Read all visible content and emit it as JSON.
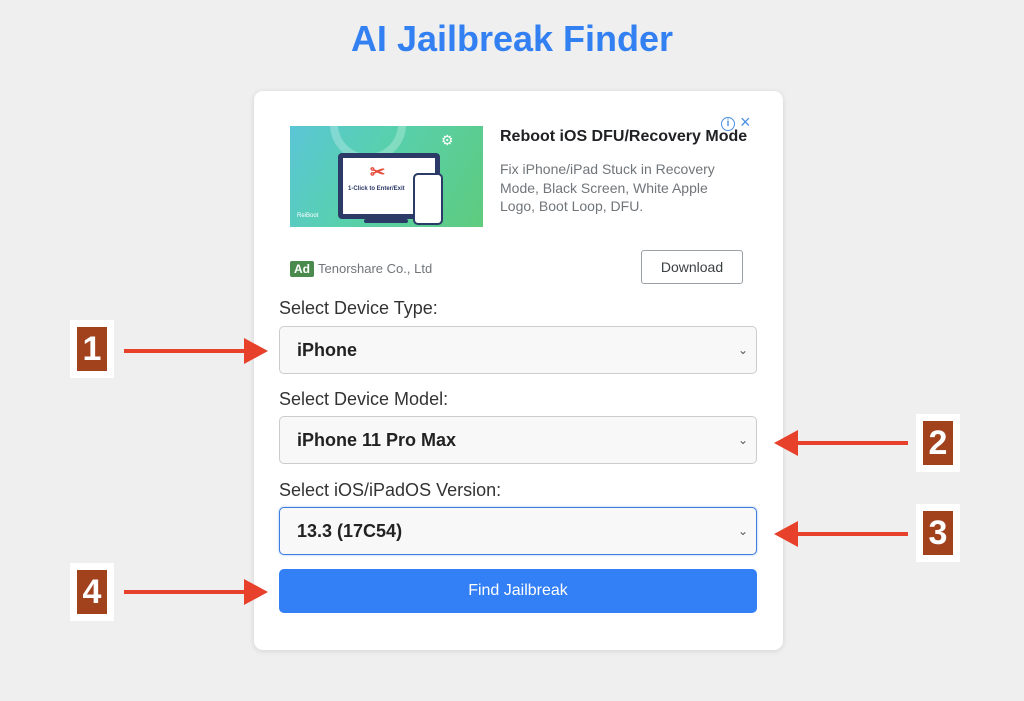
{
  "page": {
    "title": "AI Jailbreak Finder"
  },
  "ad": {
    "image_caption": "1-Click to Enter/Exit",
    "image_brand": "ReiBoot",
    "headline": "Reboot iOS DFU/Recovery Mode",
    "description": "Fix iPhone/iPad Stuck in Recovery Mode, Black Screen, White Apple Logo, Boot Loop, DFU.",
    "badge": "Ad",
    "advertiser": "Tenorshare Co., Ltd",
    "cta": "Download",
    "info_icon": "i",
    "close_icon": "×"
  },
  "form": {
    "device_type": {
      "label": "Select Device Type:",
      "value": "iPhone"
    },
    "device_model": {
      "label": "Select Device Model:",
      "value": "iPhone 11 Pro Max"
    },
    "os_version": {
      "label": "Select iOS/iPadOS Version:",
      "value": "13.3 (17C54)"
    },
    "submit_label": "Find Jailbreak",
    "chevron": "⌄"
  },
  "annotations": [
    "1",
    "2",
    "3",
    "4"
  ],
  "colors": {
    "accent": "#327ff6",
    "title": "#3280f2",
    "annotation_badge": "#a1421d",
    "arrow": "#e8412b"
  }
}
